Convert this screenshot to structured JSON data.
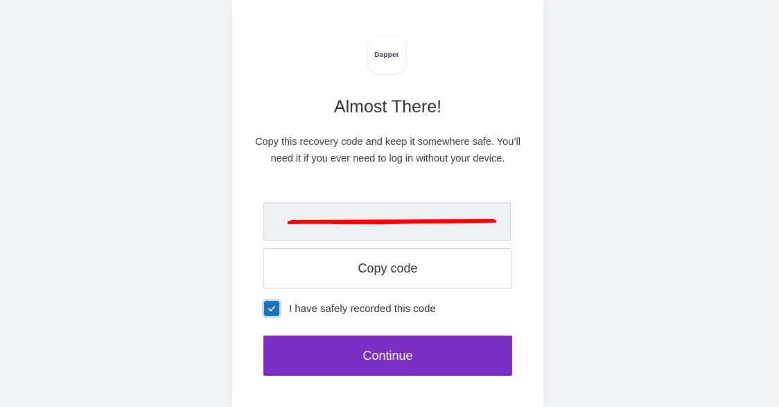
{
  "logo": {
    "text": "Dapper"
  },
  "title": "Almost There!",
  "description": "Copy this recovery code and keep it somewhere safe. You’ll need it if you ever need to log in without your device.",
  "recovery_code": {
    "value": "",
    "redacted": true
  },
  "copy_button": {
    "label": "Copy code"
  },
  "confirm_checkbox": {
    "label": "I have safely recorded this code",
    "checked": true
  },
  "continue_button": {
    "label": "Continue"
  },
  "colors": {
    "accent": "#7a2fc2",
    "checkbox": "#1f73b7",
    "redaction": "#ff0000",
    "page_background": "#f3f4f6",
    "code_background": "#eff0f4"
  },
  "icons": {
    "checkbox_mark": "check-icon"
  }
}
